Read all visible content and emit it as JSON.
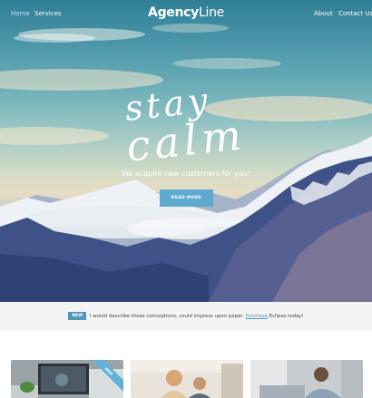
{
  "nav": {
    "left": [
      "Home",
      "Services"
    ],
    "right": [
      "About",
      "Contact Us"
    ],
    "active": "Home"
  },
  "logo": {
    "bold": "Agency",
    "light": "Line"
  },
  "hero": {
    "script_line1": "stay",
    "script_line2": "calm",
    "tagline": "We acquire new customers for you!",
    "cta_label": "READ MORE"
  },
  "notice": {
    "badge": "NEW",
    "text_before": "I would describe these conceptions, could impress upon paper.",
    "link": "Purchase",
    "text_after": "Eclipse today!"
  },
  "cards": [
    {
      "ribbon": "NEW"
    }
  ],
  "colors": {
    "accent": "#5fa9cf",
    "badge": "#4f96b8",
    "notice_bg": "#f4f4f4"
  }
}
